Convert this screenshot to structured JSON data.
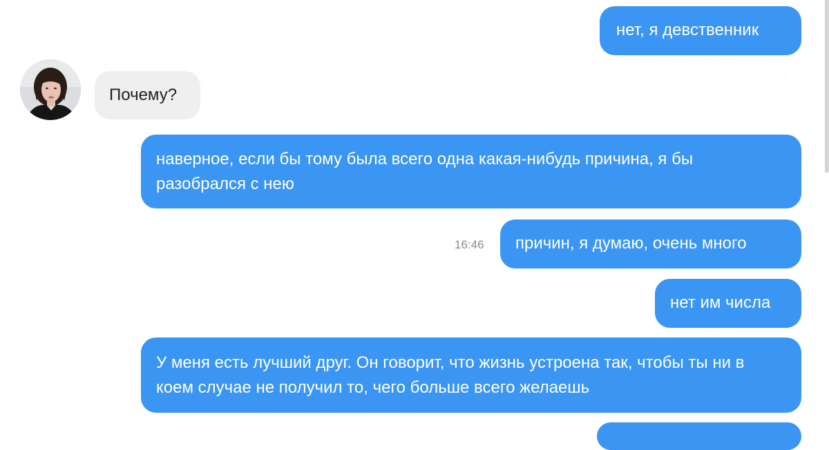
{
  "conversation": {
    "timestamp": "16:46",
    "messages": [
      {
        "direction": "outgoing",
        "text": "нет, я девственник"
      },
      {
        "direction": "incoming",
        "text": "Почему?"
      },
      {
        "direction": "outgoing",
        "text": "наверное, если бы тому была всего одна какая-нибудь причина, я бы разобрался с нею"
      },
      {
        "direction": "outgoing",
        "text": "причин, я думаю, очень много"
      },
      {
        "direction": "outgoing",
        "text": "нет им числа"
      },
      {
        "direction": "outgoing",
        "text": "У меня есть лучший друг. Он говорит, что жизнь устроена так, чтобы ты ни в коем случае не получил то, чего больше всего желаешь"
      }
    ]
  },
  "colors": {
    "outgoing_bubble": "#3a95f3",
    "incoming_bubble": "#efefef"
  },
  "icons": {
    "avatar": "contact-avatar-photo"
  }
}
